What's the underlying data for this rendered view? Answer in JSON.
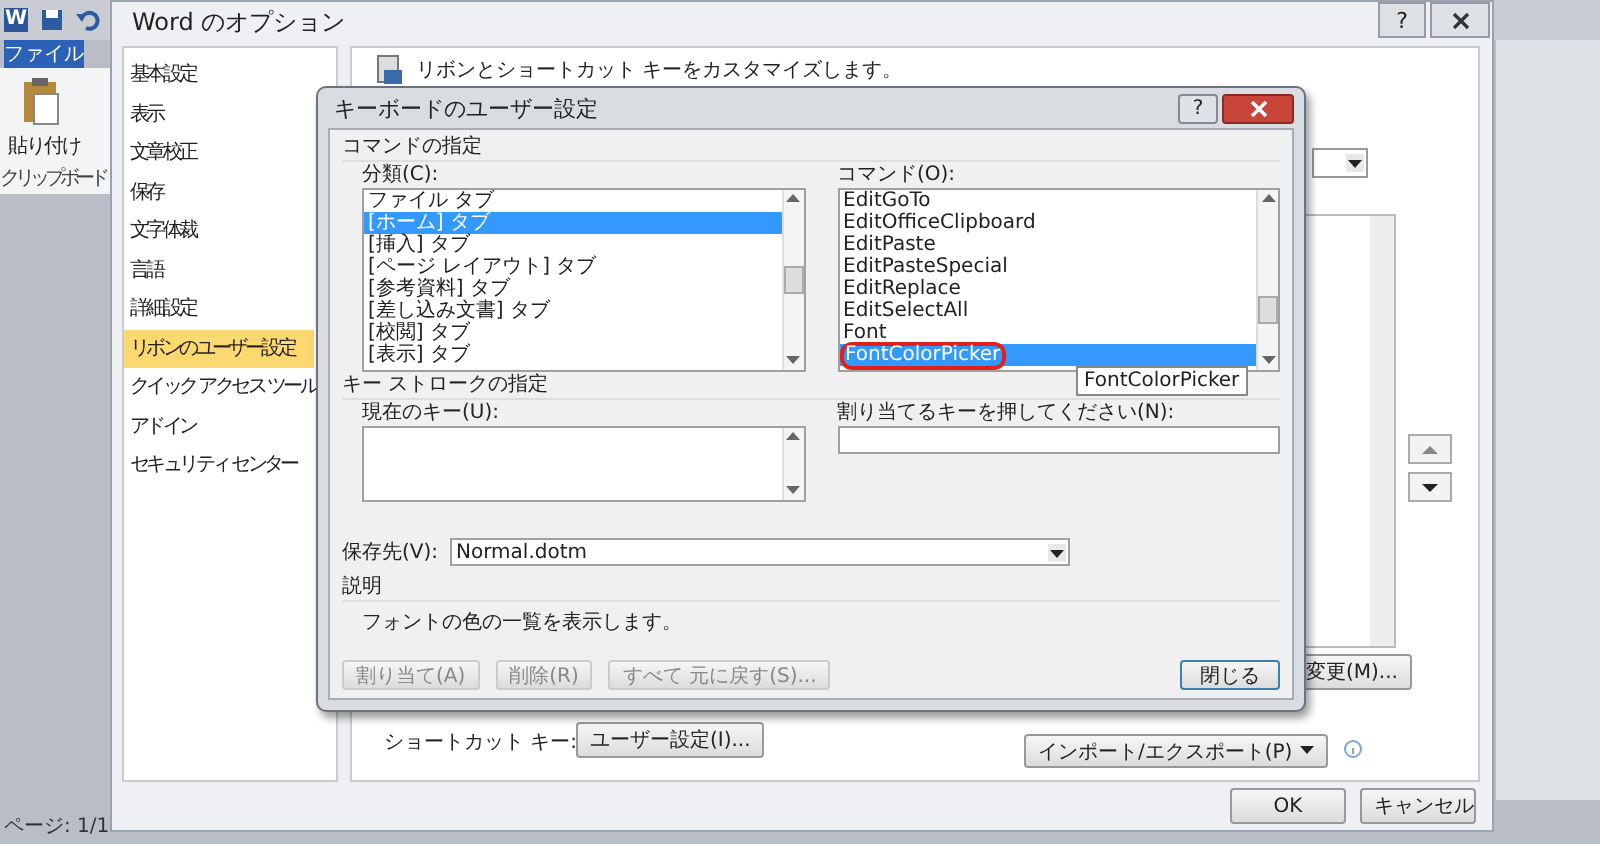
{
  "word_window": {
    "app_icon": "W",
    "file_tab": "ファイル",
    "paste_label": "貼り付け",
    "clipboard_group": "クリップボード",
    "status_bar": "ページ: 1/1"
  },
  "options_dialog": {
    "title": "Word のオプション",
    "help_button": "?",
    "nav": [
      {
        "label": "基本設定",
        "selected": false
      },
      {
        "label": "表示",
        "selected": false
      },
      {
        "label": "文章校正",
        "selected": false
      },
      {
        "label": "保存",
        "selected": false
      },
      {
        "label": "文字体裁",
        "selected": false
      },
      {
        "label": "言語",
        "selected": false
      },
      {
        "label": "詳細設定",
        "selected": false
      },
      {
        "label": "リボンのユーザー設定",
        "selected": true
      },
      {
        "label": "クイック アクセス ツール",
        "selected": false
      },
      {
        "label": "アドイン",
        "selected": false
      },
      {
        "label": "セキュリティ センター",
        "selected": false
      }
    ],
    "header": "リボンとショートカット キーをカスタマイズします。",
    "modify_button": "変更(M)...",
    "shortcut_label": "ショートカット キー:",
    "customize_button": "ユーザー設定(I)...",
    "import_export_button": "インポート/エクスポート(P)",
    "ok_button": "OK",
    "cancel_button": "キャンセル"
  },
  "keyboard_dialog": {
    "title": "キーボードのユーザー設定",
    "help_button": "?",
    "command_section": "コマンドの指定",
    "category_label": "分類(C):",
    "categories": [
      {
        "label": "ファイル タブ",
        "selected": false
      },
      {
        "label": "[ホーム] タブ",
        "selected": true
      },
      {
        "label": "[挿入] タブ",
        "selected": false
      },
      {
        "label": "[ページ レイアウト] タブ",
        "selected": false
      },
      {
        "label": "[参考資料] タブ",
        "selected": false
      },
      {
        "label": "[差し込み文書] タブ",
        "selected": false
      },
      {
        "label": "[校閲] タブ",
        "selected": false
      },
      {
        "label": "[表示] タブ",
        "selected": false
      }
    ],
    "command_label": "コマンド(O):",
    "commands": [
      {
        "label": "EditGoTo",
        "selected": false,
        "circled": false
      },
      {
        "label": "EditOfficeClipboard",
        "selected": false,
        "circled": false
      },
      {
        "label": "EditPaste",
        "selected": false,
        "circled": false
      },
      {
        "label": "EditPasteSpecial",
        "selected": false,
        "circled": false
      },
      {
        "label": "EditReplace",
        "selected": false,
        "circled": false
      },
      {
        "label": "EditSelectAll",
        "selected": false,
        "circled": false
      },
      {
        "label": "Font",
        "selected": false,
        "circled": false
      },
      {
        "label": "FontColorPicker",
        "selected": true,
        "circled": true
      }
    ],
    "tooltip": "FontColorPicker",
    "keystroke_section": "キー ストロークの指定",
    "current_keys_label": "現在のキー(U):",
    "new_key_label": "割り当てるキーを押してください(N):",
    "save_in_label": "保存先(V):",
    "save_in_value": "Normal.dotm",
    "description_section": "説明",
    "description": "フォントの色の一覧を表示します。",
    "buttons": [
      {
        "label": "割り当て(A)",
        "disabled": true
      },
      {
        "label": "削除(R)",
        "disabled": true
      },
      {
        "label": "すべて 元に戻す(S)...",
        "disabled": true
      }
    ],
    "close_button": "閉じる"
  }
}
